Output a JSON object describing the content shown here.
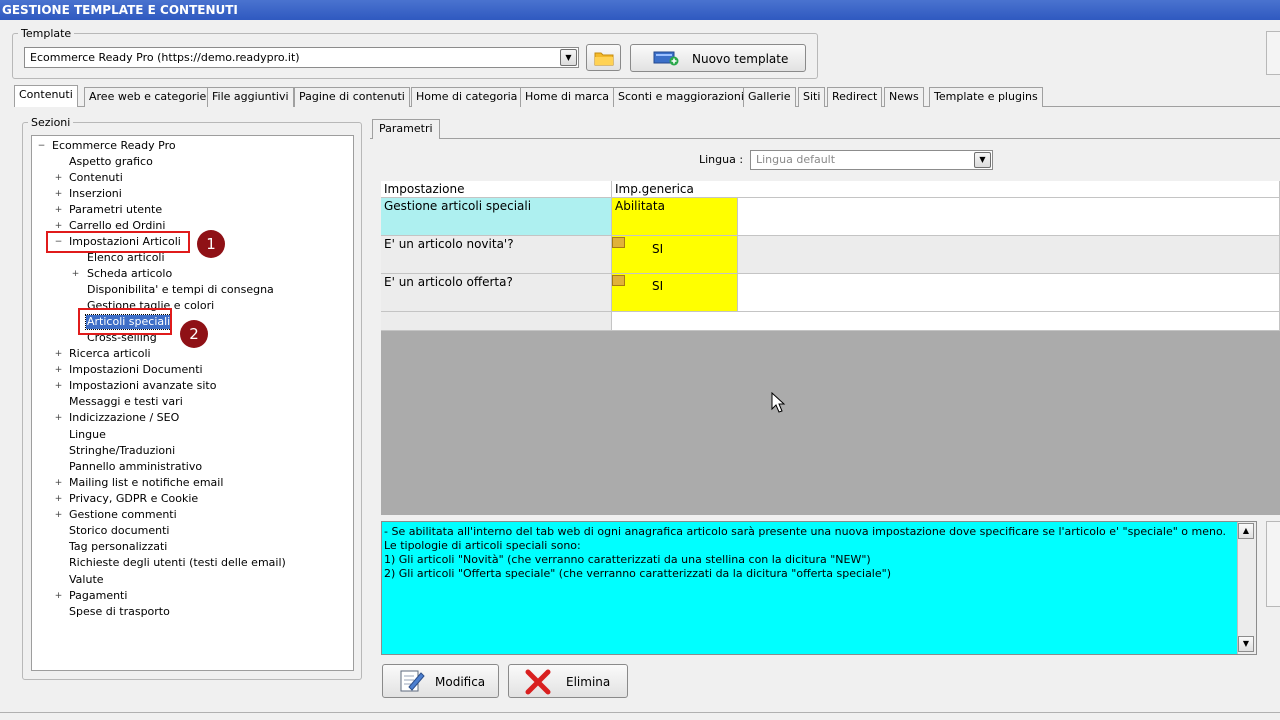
{
  "window": {
    "title": "GESTIONE TEMPLATE E CONTENUTI"
  },
  "template_group": {
    "label": "Template",
    "selected_value": "Ecommerce Ready Pro (https://demo.readypro.it)",
    "new_template_label": "Nuovo template"
  },
  "tabs": [
    {
      "label": "Contenuti",
      "active": true
    },
    {
      "label": "Aree web e categorie"
    },
    {
      "label": "File aggiuntivi"
    },
    {
      "label": "Pagine di contenuti"
    },
    {
      "label": "Home di categoria"
    },
    {
      "label": "Home di marca"
    },
    {
      "label": "Sconti e maggiorazioni"
    },
    {
      "label": "Gallerie"
    },
    {
      "label": "Siti"
    },
    {
      "label": "Redirect"
    },
    {
      "label": "News"
    },
    {
      "label": "Template e plugins"
    }
  ],
  "sections": {
    "label": "Sezioni",
    "root": "Ecommerce Ready Pro",
    "items": [
      "Aspetto grafico",
      "Contenuti",
      "Inserzioni",
      "Parametri utente",
      "Carrello ed Ordini",
      "Impostazioni Articoli",
      "Elenco articoli",
      "Scheda articolo",
      "Disponibilita' e tempi di consegna",
      "Gestione taglie e colori",
      "Articoli speciali",
      "Cross-selling",
      "Ricerca articoli",
      "Impostazioni Documenti",
      "Impostazioni avanzate sito",
      "Messaggi e testi vari",
      "Indicizzazione / SEO",
      "Lingue",
      "Stringhe/Traduzioni",
      "Pannello amministrativo",
      "Mailing list e notifiche email",
      "Privacy, GDPR e Cookie",
      "Gestione commenti",
      "Storico documenti",
      "Tag personalizzati",
      "Richieste degli utenti (testi delle email)",
      "Valute",
      "Pagamenti",
      "Spese di trasporto"
    ]
  },
  "params_tab": {
    "label": "Parametri"
  },
  "lingua": {
    "label": "Lingua :",
    "value": "Lingua default"
  },
  "grid": {
    "headers": [
      "Impostazione",
      "Imp.generica"
    ],
    "rows": [
      {
        "setting": "Gestione articoli speciali",
        "value": "Abilitata"
      },
      {
        "setting": "E' un articolo novita'?",
        "value": "SI"
      },
      {
        "setting": "E' un articolo offerta?",
        "value": "SI"
      }
    ]
  },
  "description": {
    "lines": [
      "- Se abilitata all'interno del tab web di ogni anagrafica articolo sarà presente una nuova impostazione dove specificare se l'articolo e' \"speciale\" o meno.",
      "Le tipologie di articoli speciali sono:",
      "1) Gli articoli \"Novità\" (che verranno caratterizzati da una stellina con la dicitura \"NEW\")",
      "2) Gli articoli \"Offerta speciale\" (che verranno caratterizzati da la dicitura \"offerta speciale\")"
    ]
  },
  "actions": {
    "modify_label": "Modifica",
    "delete_label": "Elimina"
  },
  "annotations": {
    "badge_1": "1",
    "badge_2": "2"
  },
  "colors": {
    "titlebar": "#2f59c0",
    "highlight_cyan": "#aef0f0",
    "highlight_yellow": "#ffff00",
    "description_bg": "#00ffff",
    "annotation_red": "#e01b1b",
    "badge": "#8f1116"
  }
}
